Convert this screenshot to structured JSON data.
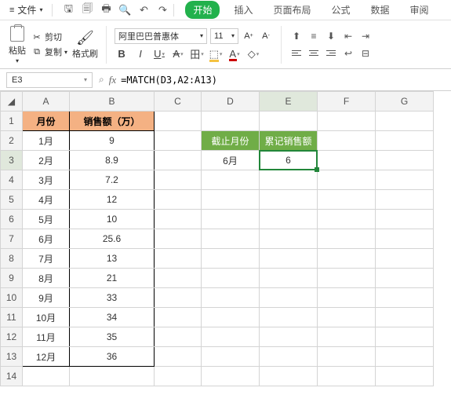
{
  "menu": {
    "file": "文件"
  },
  "tabs": {
    "start": "开始",
    "insert": "插入",
    "layout": "页面布局",
    "formula": "公式",
    "data": "数据",
    "review": "审阅"
  },
  "clipboard": {
    "paste": "粘贴",
    "cut": "剪切",
    "copy": "复制",
    "brush": "格式刷"
  },
  "font": {
    "name": "阿里巴巴普惠体",
    "size": "11"
  },
  "namebox": {
    "ref": "E3"
  },
  "formula": {
    "value": "=MATCH(D3,A2:A13)"
  },
  "cols": [
    "A",
    "B",
    "C",
    "D",
    "E",
    "F",
    "G"
  ],
  "rows": [
    "1",
    "2",
    "3",
    "4",
    "5",
    "6",
    "7",
    "8",
    "9",
    "10",
    "11",
    "12",
    "13",
    "14"
  ],
  "headers": {
    "a": "月份",
    "b": "销售额（万）",
    "d": "截止月份",
    "e": "累记销售额"
  },
  "tableA": [
    {
      "m": "1月",
      "v": "9"
    },
    {
      "m": "2月",
      "v": "8.9"
    },
    {
      "m": "3月",
      "v": "7.2"
    },
    {
      "m": "4月",
      "v": "12"
    },
    {
      "m": "5月",
      "v": "10"
    },
    {
      "m": "6月",
      "v": "25.6"
    },
    {
      "m": "7月",
      "v": "13"
    },
    {
      "m": "8月",
      "v": "21"
    },
    {
      "m": "9月",
      "v": "33"
    },
    {
      "m": "10月",
      "v": "34"
    },
    {
      "m": "11月",
      "v": "35"
    },
    {
      "m": "12月",
      "v": "36"
    }
  ],
  "d3": "6月",
  "e3": "6"
}
